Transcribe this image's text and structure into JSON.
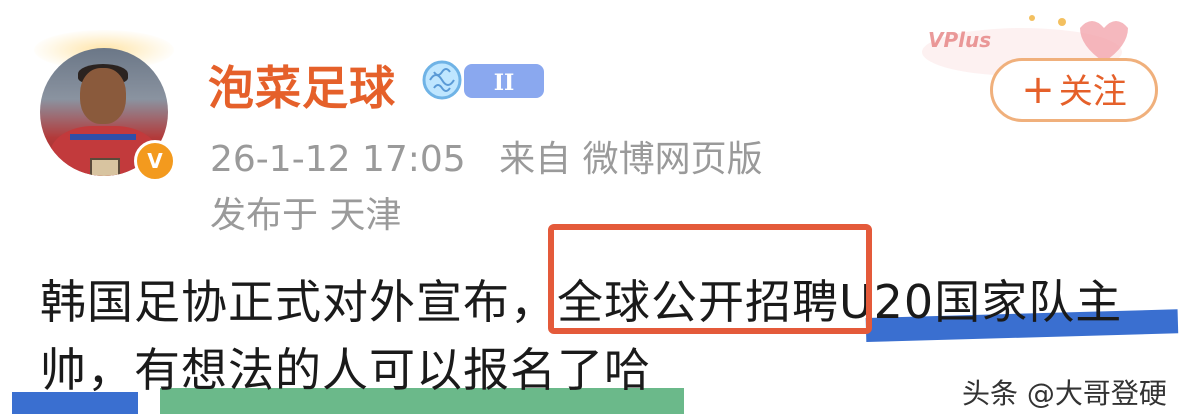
{
  "post": {
    "username": "泡菜足球",
    "level_badge": "II",
    "verified_mark": "V",
    "timestamp": "26-1-12 17:05",
    "source": "来自 微博网页版",
    "location": "发布于 天津",
    "follow_label": "关注",
    "follow_plus": "+",
    "body_line1_part1": "韩国足协正式对外宣布，",
    "body_line1_part2": "全球公开招聘",
    "body_line1_part3": "U20国家队主",
    "body_line2": "帅，有想法的人可以报名了哈"
  },
  "decoration": {
    "vplus_text": "VPlus"
  },
  "watermark": {
    "text": "头条 @大哥登硬"
  },
  "colors": {
    "username": "#e5602a",
    "meta": "#9a9a9a",
    "follow_border": "#f0b07c",
    "red_box": "#e45a3a",
    "blue_mark": "#3a6fd0",
    "green_mark": "#6bb98a",
    "verified": "#f39a1e"
  },
  "icons": {
    "verified": "verified-v-icon",
    "level": "brain-level-icon",
    "decoration": "vplus-decoration-icon"
  }
}
